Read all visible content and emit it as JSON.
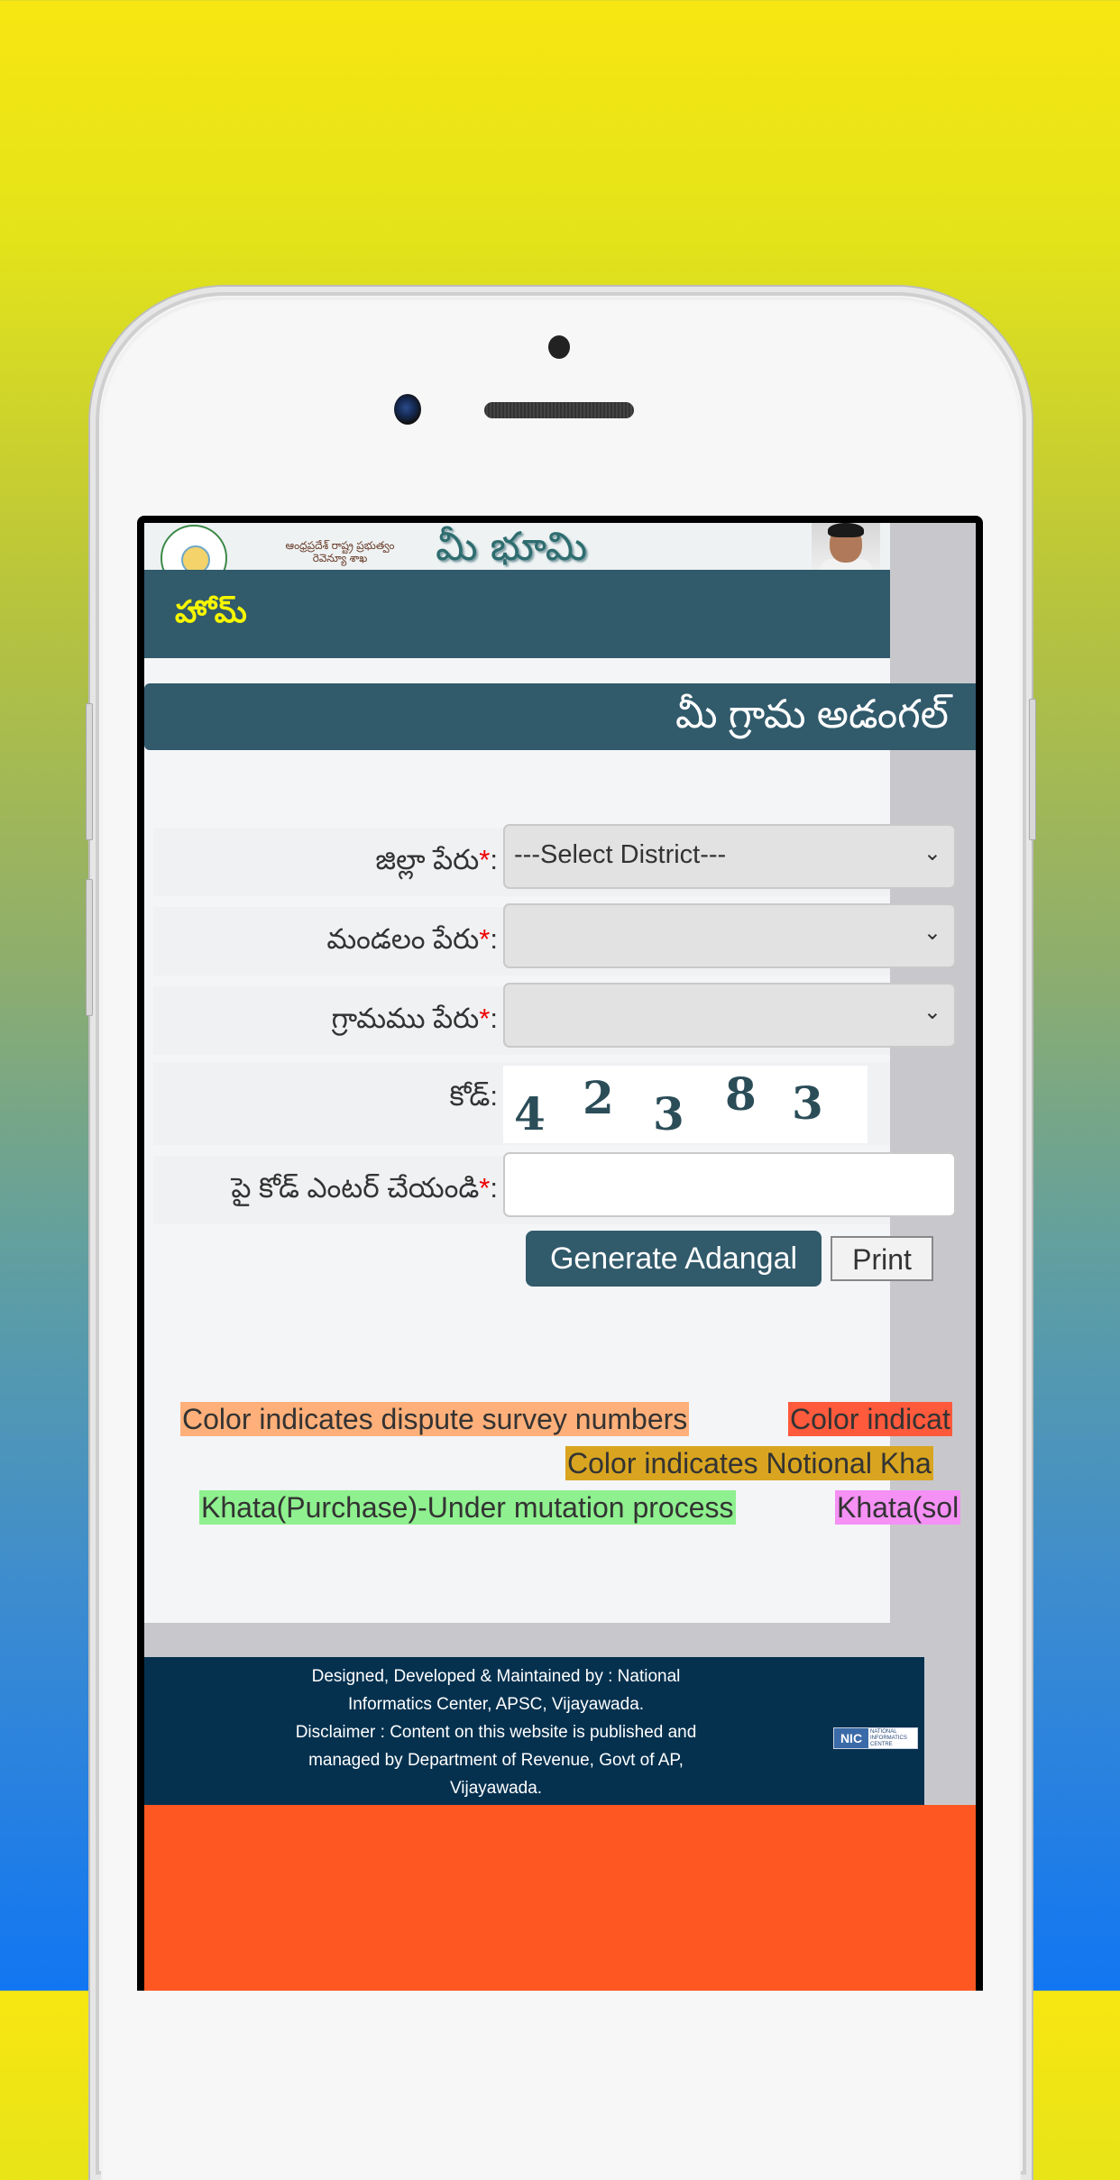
{
  "header": {
    "gov_text_line1": "ఆంధ్రప్రదేశ్ రాష్ట్ర ప్రభుత్వం",
    "gov_text_line2": "రెవెన్యూ శాఖ",
    "brand": "మీ భూమి"
  },
  "nav": {
    "home_label": "హోమ్"
  },
  "page_title": "మీ గ్రామ అడంగల్",
  "form": {
    "district_label": "జిల్లా పేరు",
    "district_value": "---Select District---",
    "mandal_label": "మండలం పేరు",
    "mandal_value": "",
    "village_label": "గ్రామము పేరు",
    "village_value": "",
    "code_label": "కోడ్:",
    "captcha_digits": [
      "4",
      "2",
      "3",
      "8",
      "3"
    ],
    "enter_code_label": "పై కోడ్ ఎంటర్ చేయండి",
    "enter_code_value": "",
    "required_mark": "*",
    "colon": ":",
    "generate_button": "Generate Adangal",
    "print_button": "Print"
  },
  "legend": [
    {
      "text": "Color indicates dispute survey numbers",
      "color": "#ffb07a"
    },
    {
      "text": "Color indicat",
      "color": "#ff5a3c"
    },
    {
      "text": "Color indicates Notional Kha",
      "color": "#d9a520"
    },
    {
      "text": "Khata(Purchase)-Under mutation process",
      "color": "#8ef08e"
    },
    {
      "text": "Khata(sol",
      "color": "#f590f5"
    }
  ],
  "footer": {
    "line1": "Designed, Developed & Maintained by : National",
    "line2": "Informatics Center, APSC, Vijayawada.",
    "line3": "Disclaimer : Content on this website is published and",
    "line4": "managed by Department of Revenue, Govt of AP,",
    "line5": "Vijayawada.",
    "nic_logo_text": "NIC",
    "nic_logo_sub": "NATIONAL INFORMATICS CENTRE"
  },
  "colors": {
    "primary": "#315a6b",
    "nav_text": "#f5f500",
    "footer_bg": "#05314f",
    "accent_bottom": "#ff5722"
  }
}
